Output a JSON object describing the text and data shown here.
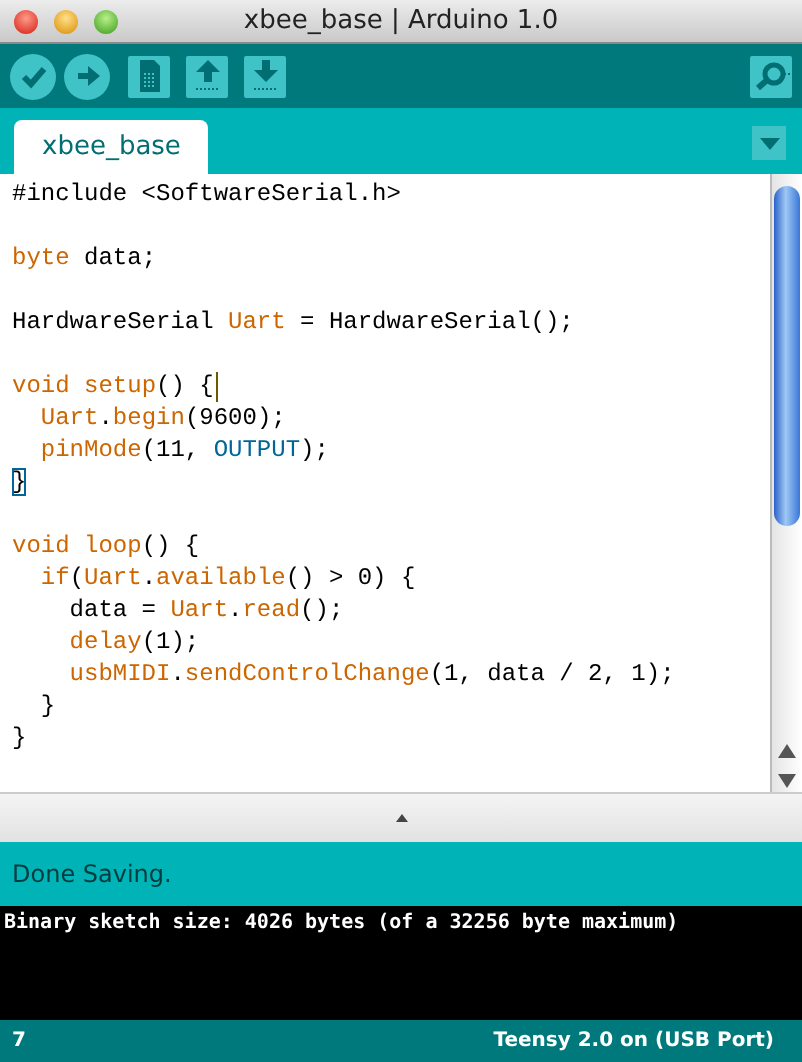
{
  "window": {
    "title": "xbee_base | Arduino 1.0"
  },
  "toolbar": {
    "buttons": [
      {
        "kind": "verify"
      },
      {
        "kind": "upload"
      },
      {
        "kind": "new"
      },
      {
        "kind": "open"
      },
      {
        "kind": "save"
      }
    ],
    "right_button": {
      "kind": "monitor"
    }
  },
  "tabs": [
    {
      "label": "xbee_base",
      "selected": true
    }
  ],
  "editor": {
    "lines": [
      {
        "kind": "code",
        "tokens": [
          {
            "text": "#include <SoftwareSerial.h>",
            "kind": "plain"
          }
        ]
      },
      {
        "kind": "blank"
      },
      {
        "kind": "code",
        "tokens": [
          {
            "text": "byte",
            "kind": "keyword"
          },
          {
            "text": " data;",
            "kind": "plain"
          }
        ]
      },
      {
        "kind": "blank"
      },
      {
        "kind": "code",
        "tokens": [
          {
            "text": "HardwareSerial ",
            "kind": "plain"
          },
          {
            "text": "Uart",
            "kind": "keyword"
          },
          {
            "text": " = HardwareSerial();",
            "kind": "plain"
          }
        ]
      },
      {
        "kind": "blank"
      },
      {
        "kind": "code",
        "tokens": [
          {
            "text": "void",
            "kind": "keyword"
          },
          {
            "text": " setup",
            "kind": "keyword"
          },
          {
            "text": "() {",
            "kind": "plain"
          }
        ],
        "cursor": true
      },
      {
        "kind": "code",
        "tokens": [
          {
            "text": "  Uart",
            "kind": "keyword"
          },
          {
            "text": ".",
            "kind": "plain"
          },
          {
            "text": "begin",
            "kind": "keyword"
          },
          {
            "text": "(9600);",
            "kind": "plain"
          }
        ]
      },
      {
        "kind": "code",
        "tokens": [
          {
            "text": "  pinMode",
            "kind": "keyword"
          },
          {
            "text": "(11, ",
            "kind": "plain"
          },
          {
            "text": "OUTPUT",
            "kind": "constant"
          },
          {
            "text": ");",
            "kind": "plain"
          }
        ]
      },
      {
        "kind": "code",
        "tokens": [
          {
            "text": "}",
            "kind": "matched"
          }
        ]
      },
      {
        "kind": "blank"
      },
      {
        "kind": "code",
        "tokens": [
          {
            "text": "void",
            "kind": "keyword"
          },
          {
            "text": " loop",
            "kind": "keyword"
          },
          {
            "text": "() {",
            "kind": "plain"
          }
        ]
      },
      {
        "kind": "code",
        "tokens": [
          {
            "text": "  if",
            "kind": "keyword"
          },
          {
            "text": "(",
            "kind": "plain"
          },
          {
            "text": "Uart",
            "kind": "keyword"
          },
          {
            "text": ".",
            "kind": "plain"
          },
          {
            "text": "available",
            "kind": "keyword"
          },
          {
            "text": "() > 0) {",
            "kind": "plain"
          }
        ]
      },
      {
        "kind": "code",
        "tokens": [
          {
            "text": "    data = ",
            "kind": "plain"
          },
          {
            "text": "Uart",
            "kind": "keyword"
          },
          {
            "text": ".",
            "kind": "plain"
          },
          {
            "text": "read",
            "kind": "keyword"
          },
          {
            "text": "();",
            "kind": "plain"
          }
        ]
      },
      {
        "kind": "code",
        "tokens": [
          {
            "text": "    delay",
            "kind": "keyword"
          },
          {
            "text": "(1);",
            "kind": "plain"
          }
        ]
      },
      {
        "kind": "code",
        "tokens": [
          {
            "text": "    usbMIDI",
            "kind": "keyword"
          },
          {
            "text": ".",
            "kind": "plain"
          },
          {
            "text": "sendControlChange",
            "kind": "keyword"
          },
          {
            "text": "(1, data / 2, 1);",
            "kind": "plain"
          }
        ]
      },
      {
        "kind": "code",
        "tokens": [
          {
            "text": "  }",
            "kind": "plain"
          }
        ]
      },
      {
        "kind": "code",
        "tokens": [
          {
            "text": "}",
            "kind": "plain"
          }
        ]
      }
    ]
  },
  "status": {
    "message": "Done Saving."
  },
  "console": {
    "lines": [
      "Binary sketch size: 4026 bytes (of a 32256 byte maximum)"
    ]
  },
  "footer": {
    "line_number": "7",
    "board": "Teensy 2.0 on (USB Port)"
  }
}
